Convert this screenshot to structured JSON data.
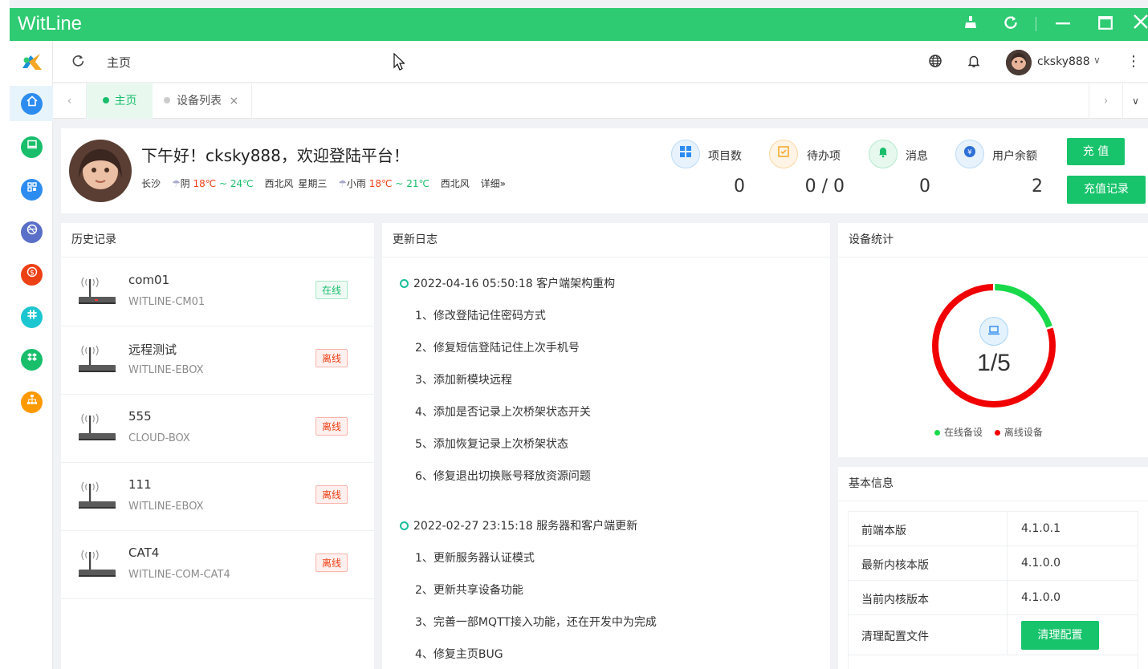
{
  "window": {
    "title": "WitLine",
    "controls": {
      "clean": "clean-icon",
      "refresh": "refresh-icon",
      "minimize": "minimize-icon",
      "maximize": "maximize-icon",
      "close": "close-icon"
    }
  },
  "sidebar": {
    "items": [
      {
        "icon": "home-icon",
        "color": "#2d8cf0",
        "glyph": "⌂"
      },
      {
        "icon": "monitor-icon",
        "color": "#19be6b",
        "glyph": "▭"
      },
      {
        "icon": "apps-icon",
        "color": "#2d8cf0",
        "glyph": "▦"
      },
      {
        "icon": "dribbble-icon",
        "color": "#5a6fc8",
        "glyph": "◎"
      },
      {
        "icon": "dollar-icon",
        "color": "#ed4014",
        "glyph": "$"
      },
      {
        "icon": "slack-icon",
        "color": "#1cc6d0",
        "glyph": "#"
      },
      {
        "icon": "dropbox-icon",
        "color": "#19be6b",
        "glyph": "◆"
      },
      {
        "icon": "sitemap-icon",
        "color": "#ff9900",
        "glyph": "⊞"
      }
    ]
  },
  "topbar": {
    "home_label": "主页",
    "username": "cksky888",
    "username_caret": "∨",
    "more": "⋮"
  },
  "tabs": {
    "items": [
      {
        "label": "主页",
        "active": true
      },
      {
        "label": "设备列表",
        "active": false,
        "close": "×"
      }
    ]
  },
  "welcome": {
    "greeting": "下午好！cksky888，欢迎登陆平台！",
    "city": "长沙",
    "today_weather": "阴",
    "today_temp": "18℃ ~ 24℃",
    "today_wind": "西北风",
    "weekday": "星期三",
    "tomorrow_weather": "小雨",
    "tomorrow_temp": "18℃ ~ 21℃",
    "tomorrow_wind": "西北风",
    "detail_link": "详细»"
  },
  "stats": [
    {
      "label": "项目数",
      "value": "0",
      "icon": "grid-icon"
    },
    {
      "label": "待办项",
      "value": "0 / 0",
      "icon": "checkbox-icon"
    },
    {
      "label": "消息",
      "value": "0",
      "icon": "bell-icon"
    },
    {
      "label": "用户余额",
      "value": "2",
      "icon": "yen-icon"
    }
  ],
  "buttons": {
    "recharge": "充 值",
    "recharge_history": "充值记录",
    "clean_config": "清理配置"
  },
  "history": {
    "title": "历史记录",
    "devices": [
      {
        "name": "com01",
        "model": "WITLINE-CM01",
        "status": "在线",
        "online": true
      },
      {
        "name": "远程测试",
        "model": "WITLINE-EBOX",
        "status": "离线",
        "online": false
      },
      {
        "name": "555",
        "model": "CLOUD-BOX",
        "status": "离线",
        "online": false
      },
      {
        "name": "111",
        "model": "WITLINE-EBOX",
        "status": "离线",
        "online": false
      },
      {
        "name": "CAT4",
        "model": "WITLINE-COM-CAT4",
        "status": "离线",
        "online": false
      }
    ]
  },
  "changelog": {
    "title": "更新日志",
    "entries": [
      {
        "head": "2022-04-16 05:50:18 客户端架构重构",
        "items": [
          "1、修改登陆记住密码方式",
          "2、修复短信登陆记住上次手机号",
          "3、添加新模块远程",
          "4、添加是否记录上次桥架状态开关",
          "5、添加恢复记录上次桥架状态",
          "6、修复退出切换账号释放资源问题"
        ]
      },
      {
        "head": "2022-02-27 23:15:18 服务器和客户端更新",
        "items": [
          "1、更新服务器认证模式",
          "2、更新共享设备功能",
          "3、完善一部MQTT接入功能，还在开发中为完成",
          "4、修复主页BUG"
        ]
      }
    ]
  },
  "device_stats": {
    "title": "设备统计",
    "ratio": "1/5",
    "online": 1,
    "total": 5,
    "legend_online": "在线备设",
    "legend_offline": "离线设备",
    "online_color": "#19d94a",
    "offline_color": "#f00000"
  },
  "basic_info": {
    "title": "基本信息",
    "rows": [
      {
        "k": "前端本版",
        "v": "4.1.0.1"
      },
      {
        "k": "最新内核本版",
        "v": "4.1.0.0"
      },
      {
        "k": "当前内核版本",
        "v": "4.1.0.0"
      },
      {
        "k": "清理配置文件",
        "v": ""
      }
    ]
  }
}
